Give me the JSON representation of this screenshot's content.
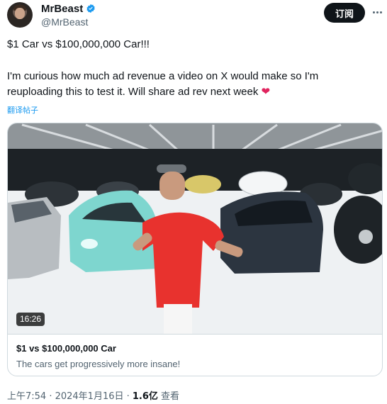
{
  "author": {
    "name": "MrBeast",
    "handle": "@MrBeast"
  },
  "header": {
    "subscribe_label": "订阅"
  },
  "tweet": {
    "title_line": "$1 Car vs $100,000,000 Car!!!",
    "body": "I'm curious how much ad revenue a video on X would make so I'm reuploading this to test it. Will share ad rev next week",
    "heart": "❤",
    "translate_label": "翻译帖子"
  },
  "card": {
    "duration": "16:26",
    "title": "$1 vs $100,000,000 Car",
    "description": "The cars get progressively more insane!"
  },
  "footer": {
    "time_date": "上午7:54 · 2024年1月16日 · ",
    "views_count": "1.6亿",
    "views_label": " 查看"
  },
  "colors": {
    "accent": "#1d9bf0",
    "heart": "#e0245e",
    "shirt": "#e8322e",
    "teal_car": "#7ed6cf"
  },
  "icons": [
    "verified-badge-icon",
    "more-options-icon",
    "heart-icon"
  ]
}
